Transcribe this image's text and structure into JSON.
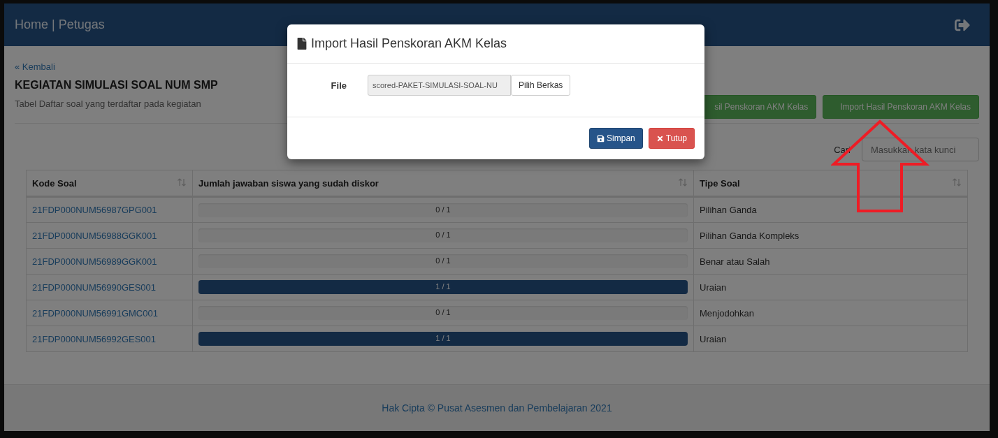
{
  "navbar": {
    "brand": "Home | Petugas"
  },
  "back_link": "« Kembali",
  "title": "KEGIATAN SIMULASI SOAL NUM SMP",
  "subtitle": "Tabel Daftar soal yang terdaftar pada kegiatan",
  "actions": [
    "sil Penskoran AKM Kelas",
    "Import Hasil Penskoran AKM Kelas"
  ],
  "search": {
    "label": "Cari",
    "placeholder": "Masukkan kata kunci"
  },
  "table": {
    "columns": [
      {
        "label": "Kode Soal"
      },
      {
        "label": "Jumlah jawaban siswa yang sudah diskor"
      },
      {
        "label": "Tipe Soal"
      }
    ],
    "rows": [
      {
        "code": "21FDP000NUM56987GPG001",
        "progress": {
          "level": 0,
          "text": "0 / 1"
        },
        "type": "Pilihan Ganda"
      },
      {
        "code": "21FDP000NUM56988GGK001",
        "progress": {
          "level": 0,
          "text": "0 / 1"
        },
        "type": "Pilihan Ganda Kompleks"
      },
      {
        "code": "21FDP000NUM56989GGK001",
        "progress": {
          "level": 0,
          "text": "0 / 1"
        },
        "type": "Benar atau Salah"
      },
      {
        "code": "21FDP000NUM56990GES001",
        "progress": {
          "level": 1,
          "text": "1 / 1"
        },
        "type": "Uraian"
      },
      {
        "code": "21FDP000NUM56991GMC001",
        "progress": {
          "level": 0,
          "text": "0 / 1"
        },
        "type": "Menjodohkan"
      },
      {
        "code": "21FDP000NUM56992GES001",
        "progress": {
          "level": 1,
          "text": "1 / 1"
        },
        "type": "Uraian"
      }
    ]
  },
  "footer": "Hak Cipta © Pusat Asesmen dan Pembelajaran 2021",
  "modal": {
    "title": "Import Hasil Penskoran AKM Kelas",
    "field_label": "File",
    "file_value": "scored-PAKET-SIMULASI-SOAL-NU",
    "browse": "Pilih Berkas",
    "buttons": [
      {
        "label": "Simpan",
        "kind": "save"
      },
      {
        "label": "Tutup",
        "kind": "close"
      }
    ]
  }
}
